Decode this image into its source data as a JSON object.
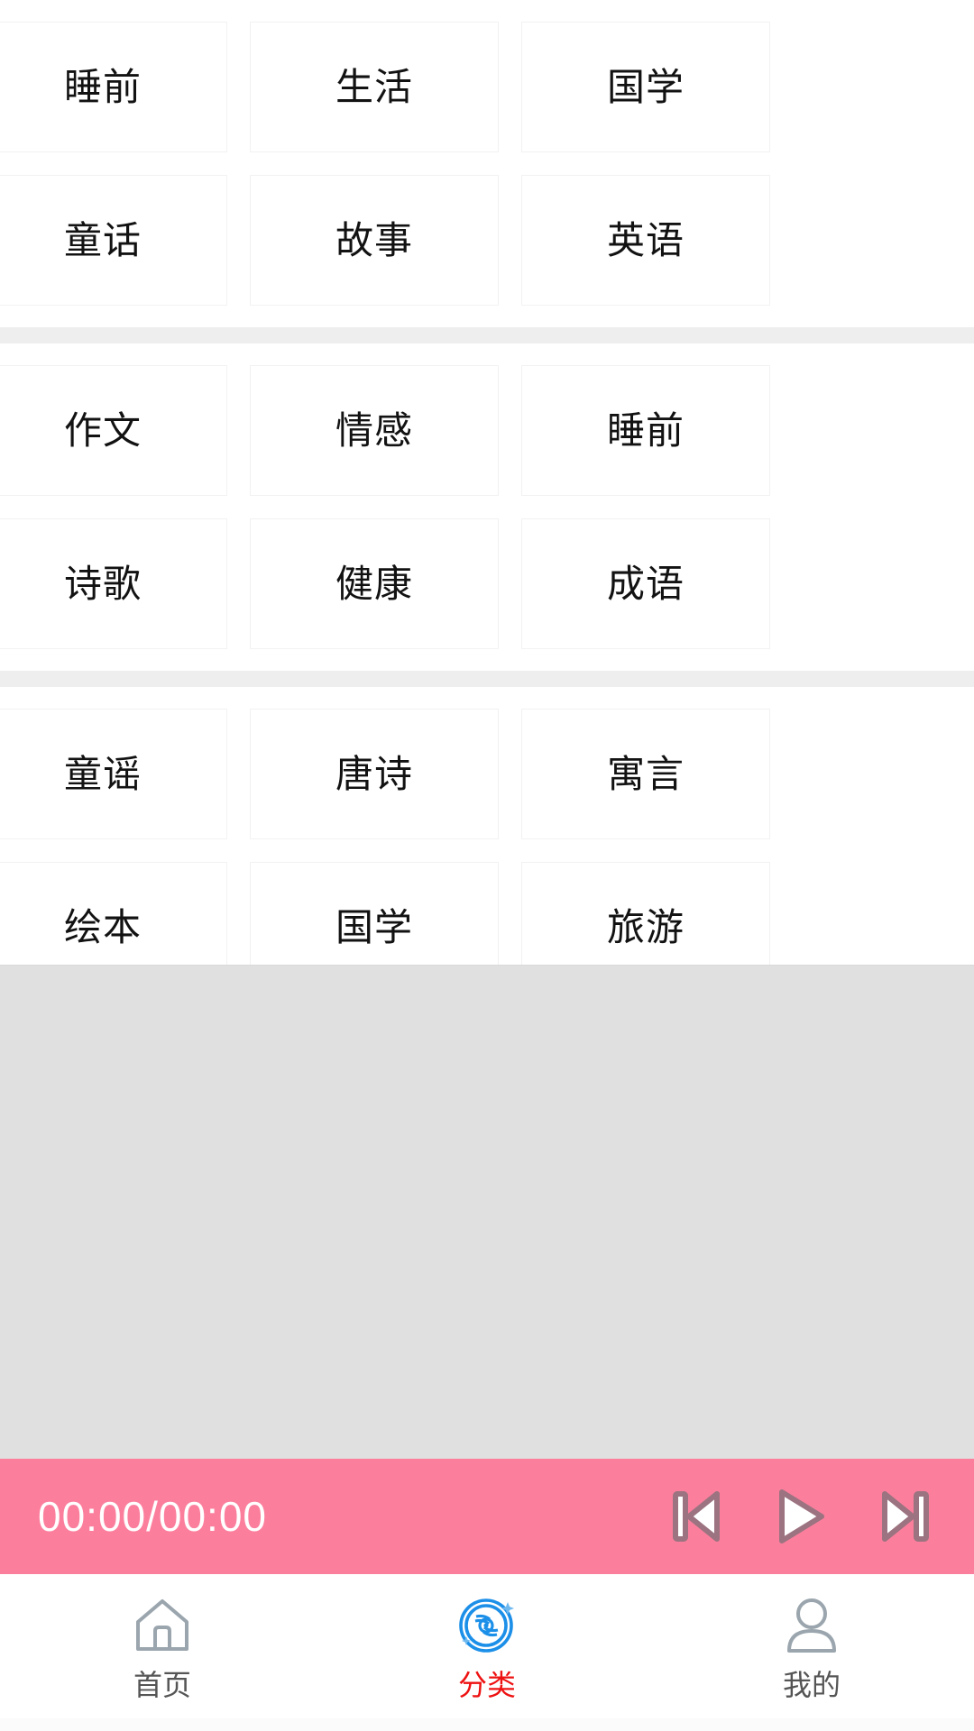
{
  "categories": {
    "sections": [
      {
        "id": "section-1",
        "items": [
          {
            "label": "睡前"
          },
          {
            "label": "生活"
          },
          {
            "label": "国学"
          },
          {
            "label": "童话"
          },
          {
            "label": "故事"
          },
          {
            "label": "英语"
          }
        ]
      },
      {
        "id": "section-2",
        "items": [
          {
            "label": "作文"
          },
          {
            "label": "情感"
          },
          {
            "label": "睡前"
          },
          {
            "label": "诗歌"
          },
          {
            "label": "健康"
          },
          {
            "label": "成语"
          }
        ]
      },
      {
        "id": "section-3",
        "items": [
          {
            "label": "童谣"
          },
          {
            "label": "唐诗"
          },
          {
            "label": "寓言"
          },
          {
            "label": "绘本"
          },
          {
            "label": "国学"
          },
          {
            "label": "旅游"
          }
        ]
      }
    ]
  },
  "player": {
    "time_display": "00:00/00:00",
    "background_color": "#fb7f9d",
    "text_color": "#ffffff",
    "controls": [
      {
        "name": "previous-track",
        "icon": "skip-previous-icon"
      },
      {
        "name": "play",
        "icon": "play-icon"
      },
      {
        "name": "next-track",
        "icon": "skip-next-icon"
      }
    ]
  },
  "bottom_nav": {
    "active_color": "#ee1111",
    "inactive_color": "#555555",
    "active_icon_color": "#1c8fe8",
    "items": [
      {
        "label": "首页",
        "icon": "home-icon",
        "active": false
      },
      {
        "label": "分类",
        "icon": "disc-icon",
        "active": true
      },
      {
        "label": "我的",
        "icon": "person-icon",
        "active": false
      }
    ]
  }
}
